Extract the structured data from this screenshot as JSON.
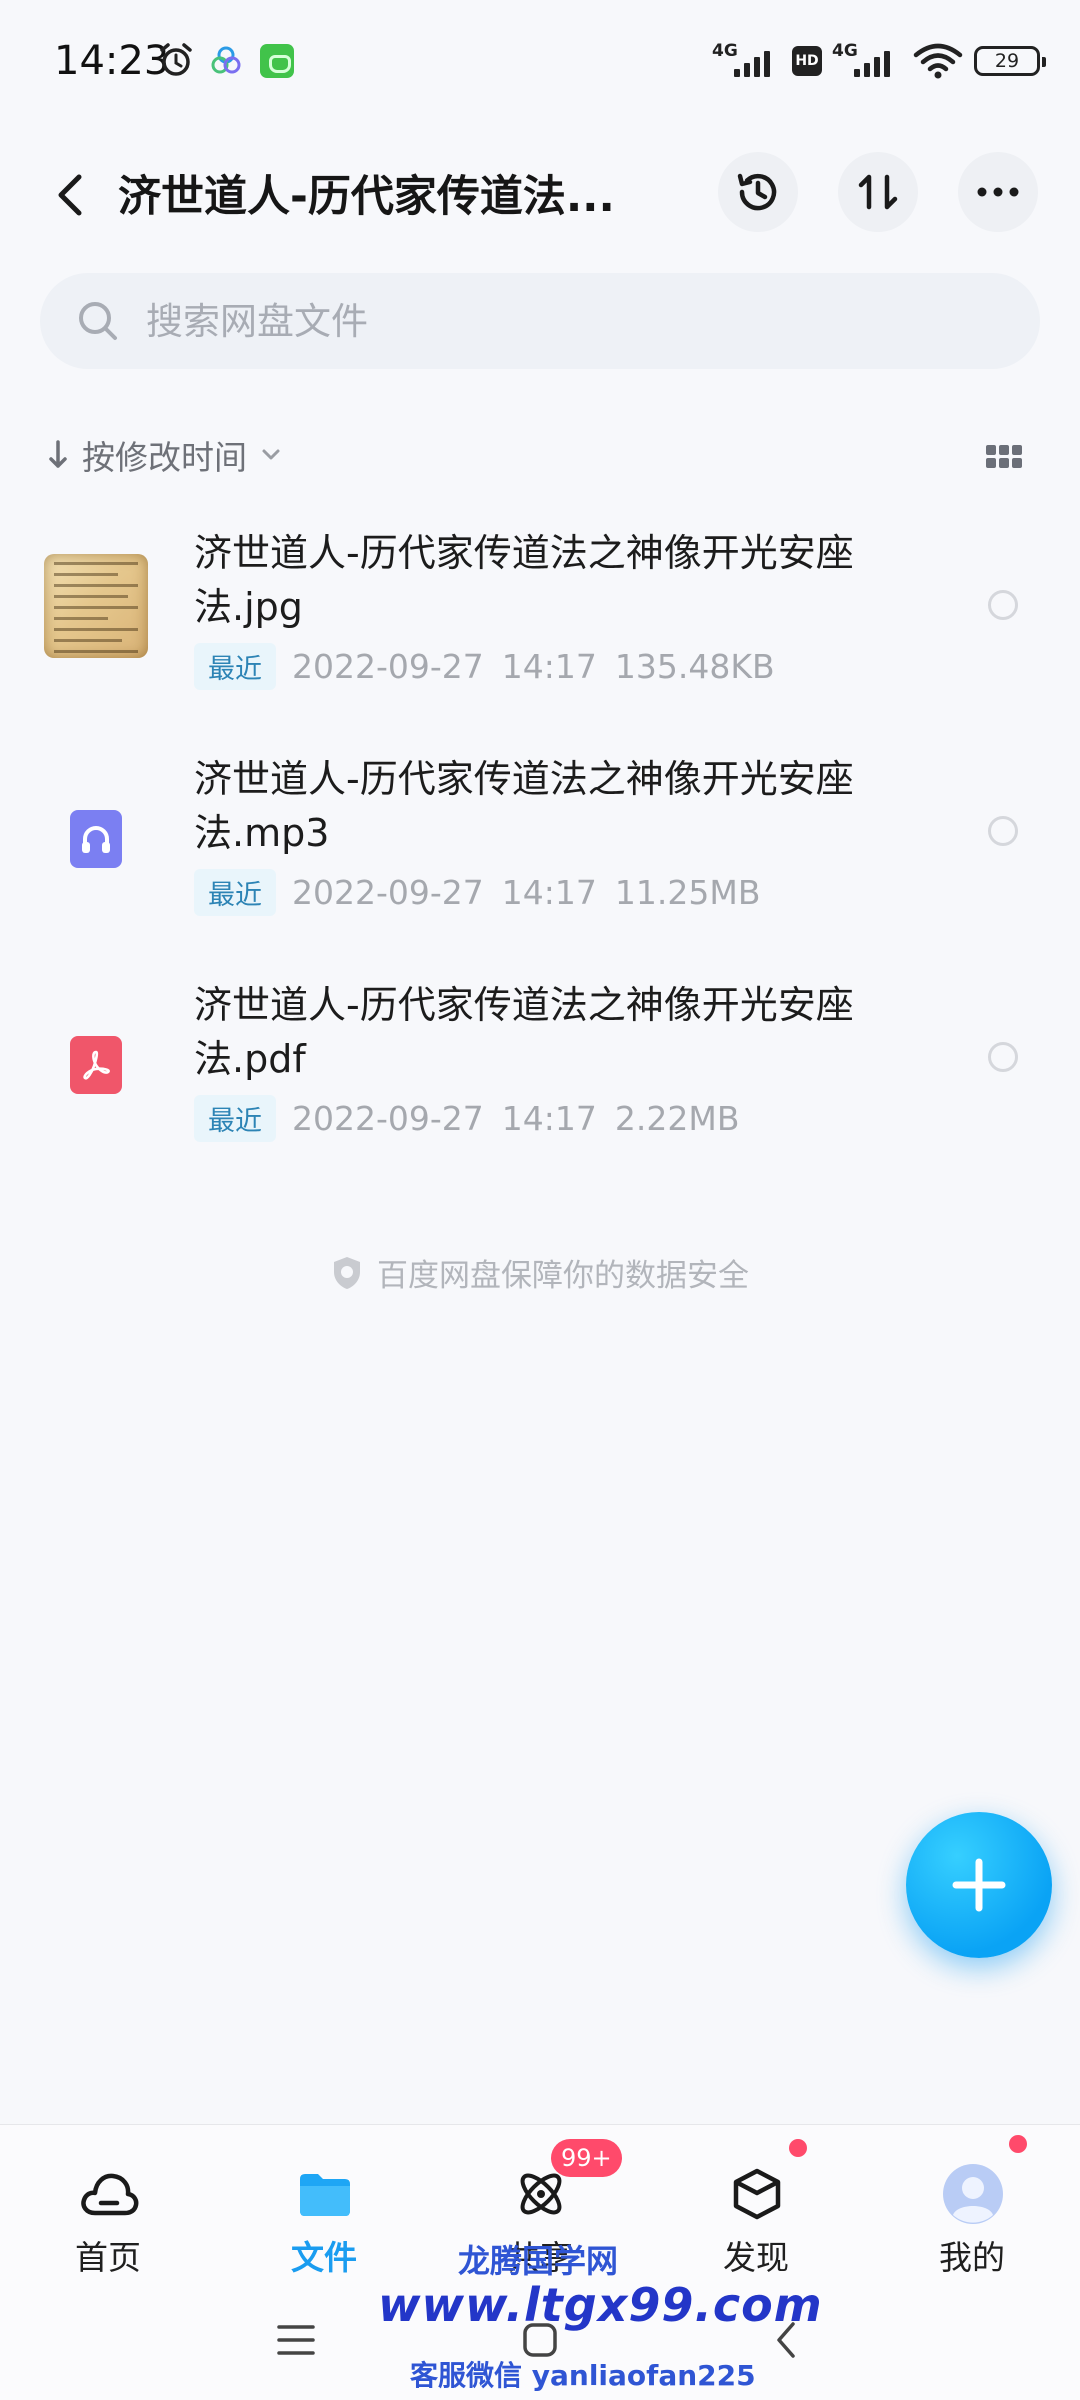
{
  "status_bar": {
    "time": "14:23",
    "network1": "4G",
    "hd": "HD",
    "network2": "4G",
    "battery": "29"
  },
  "header": {
    "title": "济世道人-历代家传道法...",
    "icons": [
      "back-arrow-icon",
      "history-icon",
      "transfer-icon",
      "more-icon"
    ]
  },
  "search": {
    "placeholder": "搜索网盘文件"
  },
  "sort": {
    "label": "按修改时间"
  },
  "files": [
    {
      "name": "济世道人-历代家传道法之神像开光安座法.jpg",
      "type": "image",
      "badge": "最近",
      "date": "2022-09-27",
      "time": "14:17",
      "size": "135.48KB"
    },
    {
      "name": "济世道人-历代家传道法之神像开光安座法.mp3",
      "type": "audio",
      "badge": "最近",
      "date": "2022-09-27",
      "time": "14:17",
      "size": "11.25MB"
    },
    {
      "name": "济世道人-历代家传道法之神像开光安座法.pdf",
      "type": "pdf",
      "badge": "最近",
      "date": "2022-09-27",
      "time": "14:17",
      "size": "2.22MB"
    }
  ],
  "security_note": "百度网盘保障你的数据安全",
  "bottom_nav": [
    {
      "label": "首页",
      "icon": "cloud-home-icon"
    },
    {
      "label": "文件",
      "icon": "folder-icon",
      "active": true
    },
    {
      "label": "共享",
      "icon": "share-orbit-icon",
      "badge": "99+"
    },
    {
      "label": "发现",
      "icon": "cube-discover-icon"
    },
    {
      "label": "我的",
      "icon": "avatar-icon"
    }
  ],
  "watermark": {
    "line1": "龙腾国学网",
    "line2": "www.ltgx99.com",
    "line3": "客服微信 yanliaofan225"
  },
  "colors": {
    "accent": "#1a9cf0",
    "badge": "#ff4a6b",
    "background": "#f7f8fb"
  }
}
